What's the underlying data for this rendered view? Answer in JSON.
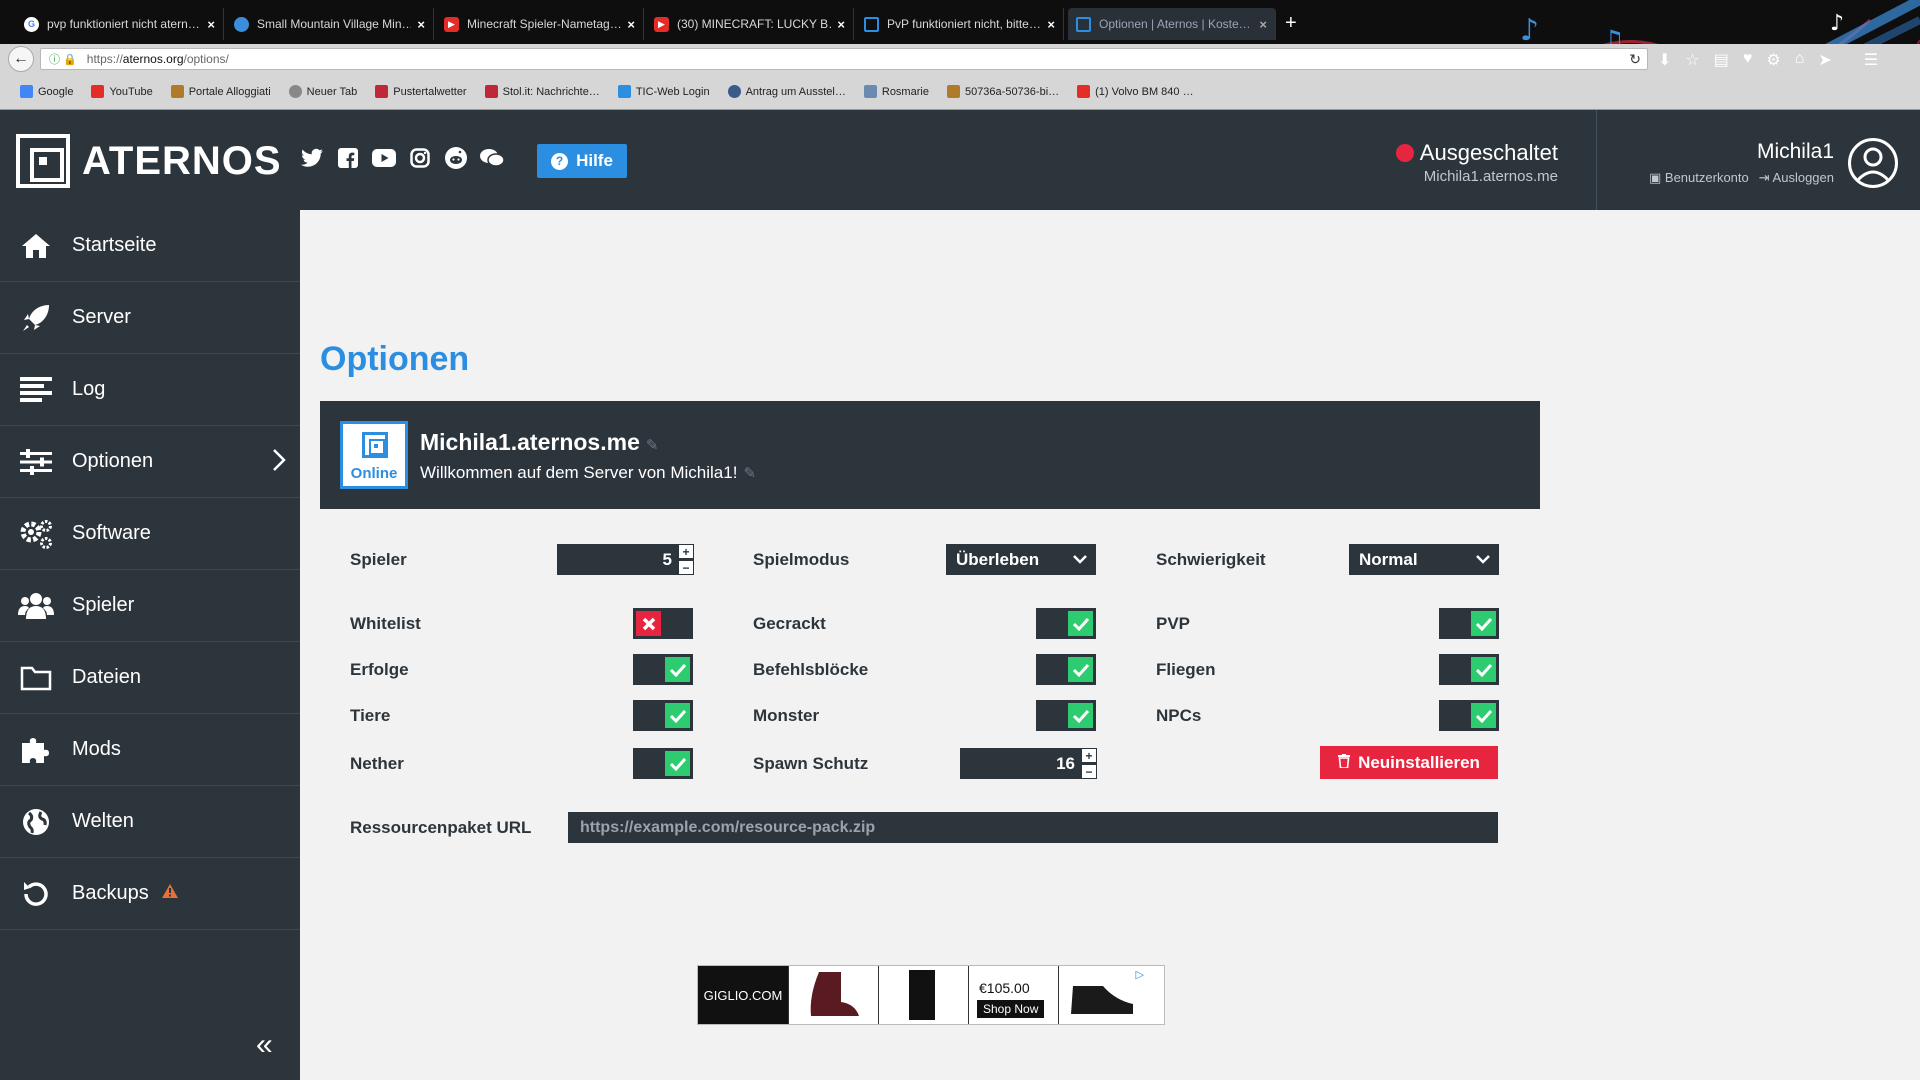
{
  "browser": {
    "tabs": [
      {
        "label": "pvp funktioniert nicht atern…",
        "icon": "google-icon",
        "color": "#ffffff"
      },
      {
        "label": "Small Mountain Village Min…",
        "icon": "globe-icon",
        "color": "#3a8edc"
      },
      {
        "label": "Minecraft Spieler-Nametag…",
        "icon": "youtube-icon",
        "color": "#e52d27"
      },
      {
        "label": "(30) MINECRAFT: LUCKY B…",
        "icon": "youtube-icon",
        "color": "#e52d27"
      },
      {
        "label": "PvP funktioniert nicht, bitte…",
        "icon": "aternos-icon",
        "color": "#2b8ee0"
      },
      {
        "label": "Optionen | Aternos | Koste…",
        "icon": "aternos-icon",
        "color": "#2b8ee0"
      }
    ],
    "url_prefix": "https://",
    "url_domain": "aternos.org",
    "url_path": "/options/",
    "bookmarks": [
      {
        "label": "Google",
        "color": "#4285f4"
      },
      {
        "label": "YouTube",
        "color": "#e52d27"
      },
      {
        "label": "Portale Alloggiati",
        "color": "#b07a2a"
      },
      {
        "label": "Neuer Tab",
        "color": "#888888"
      },
      {
        "label": "Pustertalwetter",
        "color": "#c0283a"
      },
      {
        "label": "Stol.it: Nachrichte…",
        "color": "#c0283a"
      },
      {
        "label": "TIC-Web Login",
        "color": "#2b8ee0"
      },
      {
        "label": "Antrag um Ausstel…",
        "color": "#3a5a8a"
      },
      {
        "label": "Rosmarie",
        "color": "#6a8ab0"
      },
      {
        "label": "50736a-50736-bi…",
        "color": "#b07a2a"
      },
      {
        "label": "(1) Volvo BM 840 …",
        "color": "#e52d27"
      }
    ]
  },
  "header": {
    "logo_text": "ATERNOS",
    "help_label": "Hilfe",
    "server_status": "Ausgeschaltet",
    "server_address": "Michila1.aternos.me",
    "username": "Michila1",
    "account_link": "Benutzerkonto",
    "logout_link": "Ausloggen",
    "social_icons": [
      "twitter-icon",
      "facebook-icon",
      "youtube-icon",
      "instagram-icon",
      "reddit-icon",
      "chat-icon"
    ]
  },
  "sidebar": {
    "items": [
      {
        "label": "Startseite",
        "icon": "home-icon"
      },
      {
        "label": "Server",
        "icon": "rocket-icon"
      },
      {
        "label": "Log",
        "icon": "log-icon"
      },
      {
        "label": "Optionen",
        "icon": "sliders-icon"
      },
      {
        "label": "Software",
        "icon": "gears-icon"
      },
      {
        "label": "Spieler",
        "icon": "users-icon"
      },
      {
        "label": "Dateien",
        "icon": "folder-icon"
      },
      {
        "label": "Mods",
        "icon": "puzzle-icon"
      },
      {
        "label": "Welten",
        "icon": "globe-icon"
      },
      {
        "label": "Backups",
        "icon": "backup-icon"
      }
    ]
  },
  "page": {
    "title": "Optionen",
    "server_name": "Michila1.aternos.me",
    "server_motd": "Willkommen auf dem Server von Michila1!",
    "server_badge": "Online"
  },
  "options": {
    "players_label": "Spieler",
    "players_value": "5",
    "gamemode_label": "Spielmodus",
    "gamemode_value": "Überleben",
    "difficulty_label": "Schwierigkeit",
    "difficulty_value": "Normal",
    "whitelist_label": "Whitelist",
    "whitelist_on": false,
    "cracked_label": "Gecrackt",
    "cracked_on": true,
    "pvp_label": "PVP",
    "pvp_on": true,
    "achievements_label": "Erfolge",
    "achievements_on": true,
    "commandblocks_label": "Befehlsblöcke",
    "commandblocks_on": true,
    "flying_label": "Fliegen",
    "flying_on": true,
    "animals_label": "Tiere",
    "animals_on": true,
    "monsters_label": "Monster",
    "monsters_on": true,
    "npcs_label": "NPCs",
    "npcs_on": true,
    "nether_label": "Nether",
    "nether_on": true,
    "spawn_label": "Spawn Schutz",
    "spawn_value": "16",
    "reinstall_label": "Neuinstallieren",
    "resourcepack_label": "Ressourcenpaket URL",
    "resourcepack_placeholder": "https://example.com/resource-pack.zip"
  },
  "ad": {
    "brand": "GIGLIO.COM",
    "price": "€105.00",
    "cta": "Shop Now"
  },
  "colors": {
    "accent": "#2b8ee0",
    "dark": "#2d353c",
    "on": "#2ecc71",
    "off": "#e8253f"
  }
}
